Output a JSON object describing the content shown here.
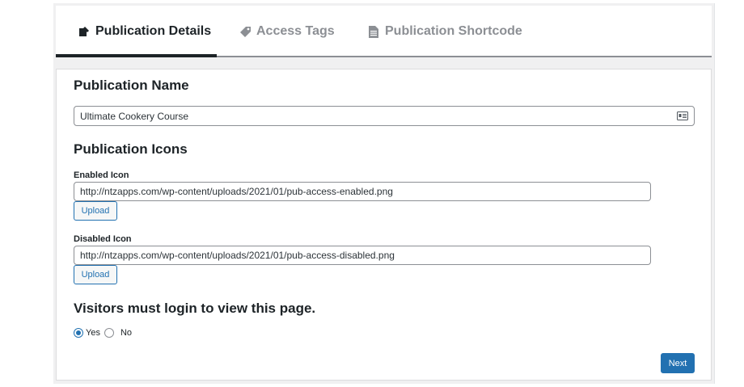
{
  "tabs": [
    {
      "label": "Publication Details",
      "icon": "edit-page-icon",
      "active": true
    },
    {
      "label": "Access Tags",
      "icon": "tag-icon",
      "active": false
    },
    {
      "label": "Publication Shortcode",
      "icon": "document-icon",
      "active": false
    }
  ],
  "form": {
    "publication_name_heading": "Publication Name",
    "publication_name_value": "Ultimate Cookery Course",
    "publication_icons_heading": "Publication Icons",
    "enabled_icon_label": "Enabled Icon",
    "enabled_icon_value": "http://ntzapps.com/wp-content/uploads/2021/01/pub-access-enabled.png",
    "disabled_icon_label": "Disabled Icon",
    "disabled_icon_value": "http://ntzapps.com/wp-content/uploads/2021/01/pub-access-disabled.png",
    "upload_label": "Upload",
    "login_heading": "Visitors must login to view this page.",
    "login_options": [
      {
        "label": "Yes",
        "checked": true
      },
      {
        "label": "No",
        "checked": false
      }
    ],
    "next_label": "Next"
  },
  "colors": {
    "accent": "#2271b1",
    "text": "#1d2327",
    "muted": "#8c8f94",
    "background": "#f0f0f1"
  }
}
